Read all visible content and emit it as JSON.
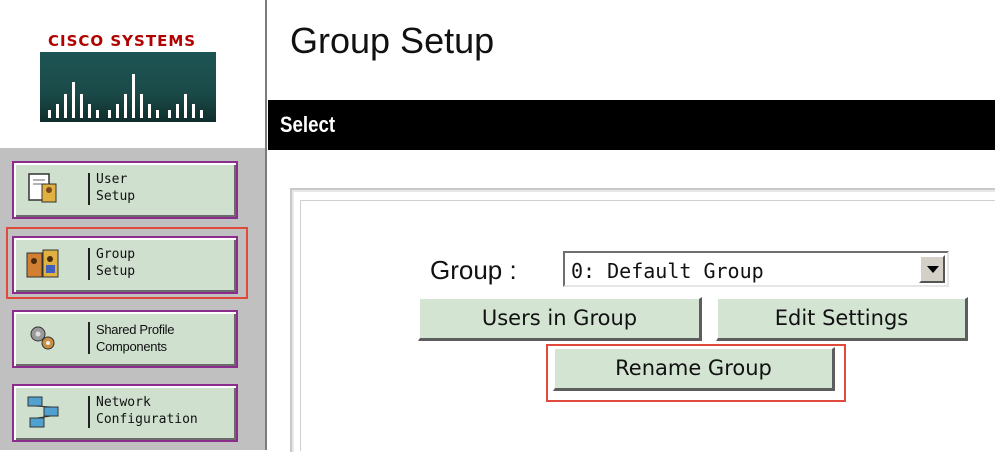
{
  "brand": {
    "logo_text": "CISCO SYSTEMS"
  },
  "header": {
    "title": "Group Setup"
  },
  "section": {
    "title": "Select"
  },
  "sidebar": {
    "items": [
      {
        "label": "User\nSetup",
        "icon": "user-setup-icon"
      },
      {
        "label": "Group\nSetup",
        "icon": "group-setup-icon",
        "highlighted": true
      },
      {
        "label": "Shared Profile\nComponents",
        "icon": "shared-profile-components-icon"
      },
      {
        "label": "Network\nConfiguration",
        "icon": "network-configuration-icon"
      }
    ]
  },
  "form": {
    "group_label": "Group :",
    "group_value": "0: Default Group",
    "buttons": {
      "users_in_group": "Users in Group",
      "edit_settings": "Edit Settings",
      "rename_group": "Rename Group"
    }
  },
  "colors": {
    "brand_red": "#b00000",
    "nav_button_bg": "#cfe0cf",
    "action_button_bg": "#d3e4d3",
    "highlight": "#e04a3a",
    "select_bar": "#000000"
  }
}
